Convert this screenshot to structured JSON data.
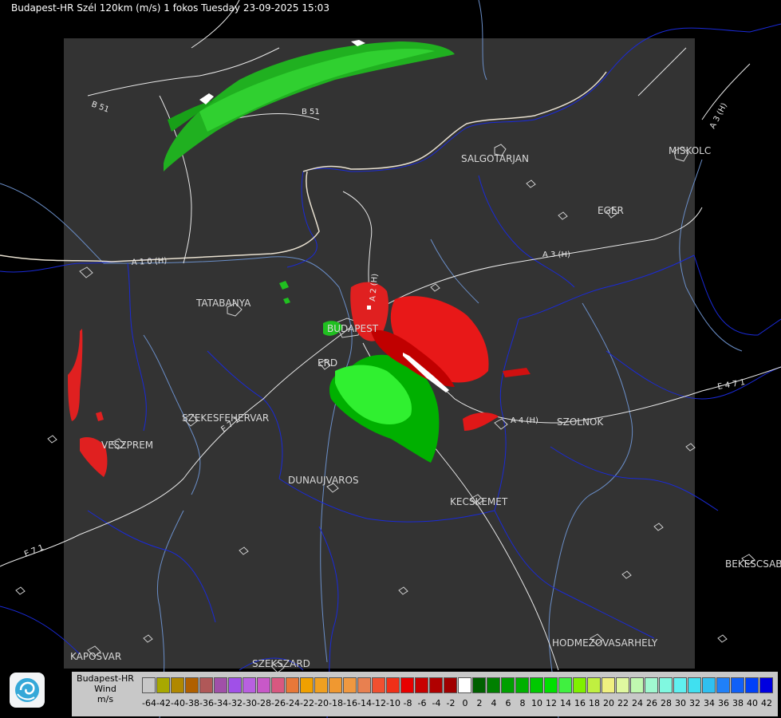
{
  "header": {
    "title": "Budapest-HR Szél 120km (m/s) 1 fokos Tuesday 23-09-2025 15:03"
  },
  "cities": [
    {
      "id": "salgotarjan",
      "label": "SALGOTARJAN"
    },
    {
      "id": "miskolc",
      "label": "MISKOLC"
    },
    {
      "id": "eger",
      "label": "EGER"
    },
    {
      "id": "tatabanya",
      "label": "TATABANYA"
    },
    {
      "id": "budapest",
      "label": "BUDAPEST"
    },
    {
      "id": "erd",
      "label": "ERD"
    },
    {
      "id": "szekesfehervar",
      "label": "SZEKESFEHERVAR"
    },
    {
      "id": "veszprem",
      "label": "VESZPREM"
    },
    {
      "id": "dunaujvaros",
      "label": "DUNAUJVAROS"
    },
    {
      "id": "kecskemet",
      "label": "KECSKEMET"
    },
    {
      "id": "szolnok",
      "label": "SZOLNOK"
    },
    {
      "id": "bekescsaba",
      "label": "BEKESCSABA"
    },
    {
      "id": "hodmezovasarhely",
      "label": "HODMEZOVASARHELY"
    },
    {
      "id": "kaposvar",
      "label": "KAPOSVAR"
    },
    {
      "id": "szekszard",
      "label": "SZEKSZARD"
    }
  ],
  "roads": [
    {
      "id": "b51-upper",
      "label": "B 51"
    },
    {
      "id": "b51-lower",
      "label": "B 51"
    },
    {
      "id": "a3h-east",
      "label": "A 3 (H)"
    },
    {
      "id": "a3h-mid",
      "label": "A 3 (H)"
    },
    {
      "id": "a1h",
      "label": "A 1 0 (H)"
    },
    {
      "id": "a2h",
      "label": "A 2 (H)"
    },
    {
      "id": "a4h",
      "label": "A 4 (H)"
    },
    {
      "id": "e71",
      "label": "E 7 1"
    },
    {
      "id": "e71sw",
      "label": "E 7 1"
    },
    {
      "id": "e471",
      "label": "E 4 7 1"
    }
  ],
  "legend": {
    "station": "Budapest-HR",
    "quantity": "Wind",
    "unit": "m/s",
    "ticks": [
      "-64",
      "-42",
      "-40",
      "-38",
      "-36",
      "-34",
      "-32",
      "-30",
      "-28",
      "-26",
      "-24",
      "-22",
      "-20",
      "-18",
      "-16",
      "-14",
      "-12",
      "-10",
      "-8",
      "-6",
      "-4",
      "-2",
      "0",
      "2",
      "4",
      "6",
      "8",
      "10",
      "12",
      "14",
      "16",
      "18",
      "20",
      "22",
      "24",
      "26",
      "28",
      "30",
      "32",
      "34",
      "36",
      "38",
      "40",
      "42"
    ],
    "colors": [
      "#c8c8c8",
      "#a8a800",
      "#b08800",
      "#b06000",
      "#b05858",
      "#a050a8",
      "#a050e8",
      "#b860e0",
      "#c858c8",
      "#d85880",
      "#e87838",
      "#f0a000",
      "#f0a020",
      "#f09830",
      "#f09840",
      "#e88050",
      "#f05030",
      "#f03018",
      "#e80000",
      "#c80000",
      "#b00000",
      "#a00000",
      "#ffffff",
      "#006000",
      "#008000",
      "#00a000",
      "#00b000",
      "#00c800",
      "#00e000",
      "#40f040",
      "#80f000",
      "#c0f040",
      "#f0f080",
      "#e0f8a0",
      "#c0f8b0",
      "#a0f8d0",
      "#80f8e0",
      "#60f0f0",
      "#40e0f0",
      "#30c0f0",
      "#2080f8",
      "#1060f8",
      "#0040f8",
      "#0000e0"
    ]
  }
}
